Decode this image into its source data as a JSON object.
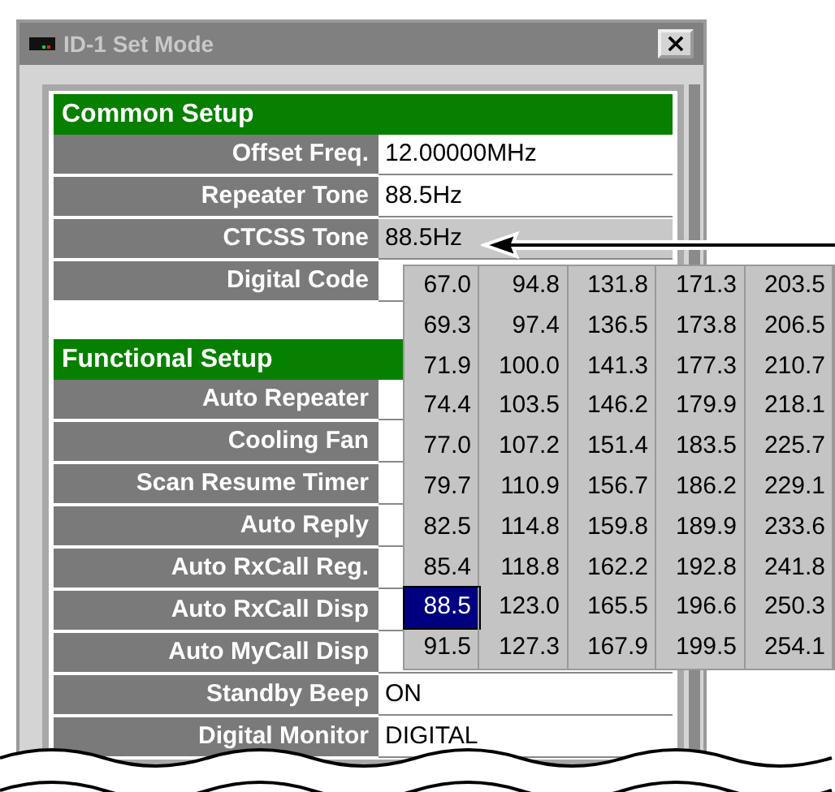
{
  "window": {
    "title": "ID-1 Set Mode",
    "close": "×"
  },
  "sections": [
    {
      "title": "Common Setup",
      "rows": [
        {
          "label": "Offset Freq.",
          "value": "12.00000MHz",
          "focused": false
        },
        {
          "label": "Repeater Tone",
          "value": "88.5Hz",
          "focused": false
        },
        {
          "label": "CTCSS Tone",
          "value": "88.5Hz",
          "focused": true
        },
        {
          "label": "Digital Code",
          "focused": false
        }
      ]
    },
    {
      "title": "Functional Setup",
      "rows": [
        {
          "label": "Auto Repeater",
          "focused": false
        },
        {
          "label": "Cooling Fan",
          "focused": false
        },
        {
          "label": "Scan Resume Timer",
          "focused": false
        },
        {
          "label": "Auto Reply",
          "focused": false
        },
        {
          "label": "Auto RxCall Reg.",
          "focused": false
        },
        {
          "label": "Auto RxCall Disp",
          "focused": false
        },
        {
          "label": "Auto MyCall Disp",
          "focused": false
        },
        {
          "label": "Standby Beep",
          "value": "ON",
          "focused": false
        },
        {
          "label": "Digital Monitor",
          "value": "DIGITAL",
          "focused": false
        }
      ]
    }
  ],
  "tone_list": {
    "items": [
      {
        "value": "67.0",
        "selected": false
      },
      {
        "value": "69.3",
        "selected": false
      },
      {
        "value": "71.9",
        "selected": false
      },
      {
        "value": "74.4",
        "selected": false
      },
      {
        "value": "77.0",
        "selected": false
      },
      {
        "value": "79.7",
        "selected": false
      },
      {
        "value": "82.5",
        "selected": false
      },
      {
        "value": "85.4",
        "selected": false
      },
      {
        "value": "88.5",
        "selected": true
      },
      {
        "value": "91.5",
        "selected": false
      },
      {
        "value": "94.8",
        "selected": false
      },
      {
        "value": "97.4",
        "selected": false
      },
      {
        "value": "100.0",
        "selected": false
      },
      {
        "value": "103.5",
        "selected": false
      },
      {
        "value": "107.2",
        "selected": false
      },
      {
        "value": "110.9",
        "selected": false
      },
      {
        "value": "114.8",
        "selected": false
      },
      {
        "value": "118.8",
        "selected": false
      },
      {
        "value": "123.0",
        "selected": false
      },
      {
        "value": "127.3",
        "selected": false
      },
      {
        "value": "131.8",
        "selected": false
      },
      {
        "value": "136.5",
        "selected": false
      },
      {
        "value": "141.3",
        "selected": false
      },
      {
        "value": "146.2",
        "selected": false
      },
      {
        "value": "151.4",
        "selected": false
      },
      {
        "value": "156.7",
        "selected": false
      },
      {
        "value": "159.8",
        "selected": false
      },
      {
        "value": "162.2",
        "selected": false
      },
      {
        "value": "165.5",
        "selected": false
      },
      {
        "value": "167.9",
        "selected": false
      },
      {
        "value": "171.3",
        "selected": false
      },
      {
        "value": "173.8",
        "selected": false
      },
      {
        "value": "177.3",
        "selected": false
      },
      {
        "value": "179.9",
        "selected": false
      },
      {
        "value": "183.5",
        "selected": false
      },
      {
        "value": "186.2",
        "selected": false
      },
      {
        "value": "189.9",
        "selected": false
      },
      {
        "value": "192.8",
        "selected": false
      },
      {
        "value": "196.6",
        "selected": false
      },
      {
        "value": "199.5",
        "selected": false
      },
      {
        "value": "203.5",
        "selected": false
      },
      {
        "value": "206.5",
        "selected": false
      },
      {
        "value": "210.7",
        "selected": false
      },
      {
        "value": "218.1",
        "selected": false
      },
      {
        "value": "225.7",
        "selected": false
      },
      {
        "value": "229.1",
        "selected": false
      },
      {
        "value": "233.6",
        "selected": false
      },
      {
        "value": "241.8",
        "selected": false
      },
      {
        "value": "250.3",
        "selected": false
      },
      {
        "value": "254.1",
        "selected": false
      }
    ]
  }
}
